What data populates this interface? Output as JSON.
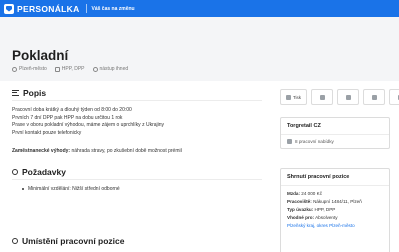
{
  "topbar": {
    "logo_text": "PERSONÁLKA",
    "slogan": "Váš čas na změnu"
  },
  "job": {
    "title": "Pokladní",
    "location": "Plzeň-město",
    "contract": "HPP, DPP",
    "start": "nástup ihned"
  },
  "share": {
    "print_label": "Tisk",
    "icons": [
      "print-icon",
      "facebook-icon",
      "twitter-icon",
      "linkedin-icon",
      "mail-icon"
    ]
  },
  "description": {
    "heading": "Popis",
    "lines": [
      "Pracovní doba krátký a dlouhý týden od 8:00 do 20:00",
      "Prvních 7 dní DPP pak HPP na dobu určitou 1 rok",
      "Praxe v oboru pokladní výhodou, máme zájem o uprchlíky z Ukrajiny",
      "První kontakt pouze telefonicky"
    ],
    "benefits_label": "Zaměstnanecké výhody:",
    "benefits_value": "náhrada stravy, po zkušební době možnost prémií"
  },
  "requirements": {
    "heading": "Požadavky",
    "items": [
      "Minimální vzdělání: Nižší střední odborné"
    ]
  },
  "location_section": {
    "heading": "Umístění pracovní pozice"
  },
  "company_card": {
    "name": "Torgretail CZ",
    "offers": "8 pracovní nabídky"
  },
  "summary_card": {
    "title": "Shrnutí pracovní pozice",
    "salary_label": "Mzda:",
    "salary_value": "24 000 Kč",
    "workplace_label": "Pracoviště:",
    "workplace_value": "Nákupní 1484/11, Plzeň",
    "type_label": "Typ úvazku:",
    "type_value": "HPP, DPP",
    "suitable_label": "Vhodné pro:",
    "suitable_value": "Absolventy",
    "link": "Plzeňský kraj, okres Plzeň-město"
  },
  "colors": {
    "brand": "#1a73e8",
    "hero_bg": "#f4f5f7"
  }
}
